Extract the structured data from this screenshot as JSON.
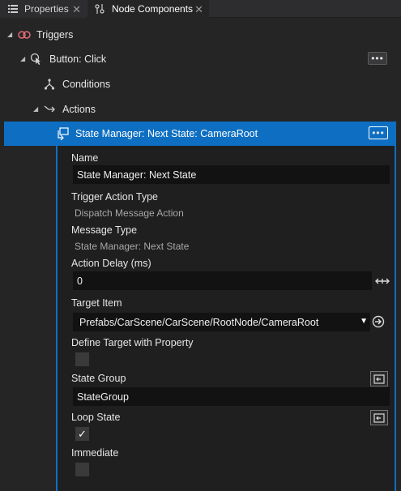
{
  "tabs": [
    {
      "label": "Properties",
      "icon": "list-icon",
      "active": false
    },
    {
      "label": "Node Components",
      "icon": "node-components-icon",
      "active": true
    }
  ],
  "tree": {
    "triggers": {
      "label": "Triggers"
    },
    "button_click": {
      "label": "Button: Click",
      "more": "•••"
    },
    "conditions": {
      "label": "Conditions"
    },
    "actions": {
      "label": "Actions"
    },
    "selected_action": {
      "label": "State Manager: Next State: CameraRoot",
      "more": "•••"
    }
  },
  "properties": {
    "name": {
      "label": "Name",
      "value": "State Manager: Next State"
    },
    "trigger_action_type": {
      "label": "Trigger Action Type",
      "value": "Dispatch Message Action"
    },
    "message_type": {
      "label": "Message Type",
      "value": "State Manager: Next State"
    },
    "action_delay": {
      "label": "Action Delay (ms)",
      "value": "0"
    },
    "target_item": {
      "label": "Target Item",
      "value": "Prefabs/CarScene/CarScene/RootNode/CameraRoot"
    },
    "define_target": {
      "label": "Define Target with Property",
      "checked": false
    },
    "state_group": {
      "label": "State Group",
      "value": "StateGroup"
    },
    "loop_state": {
      "label": "Loop State",
      "checked": true,
      "check_glyph": "✓"
    },
    "immediate": {
      "label": "Immediate",
      "checked": false
    }
  },
  "colors": {
    "accent": "#0e6fc2",
    "panel_bg": "#1f1f1f",
    "input_bg": "#121212",
    "trigger_icon": "#e06c75"
  }
}
